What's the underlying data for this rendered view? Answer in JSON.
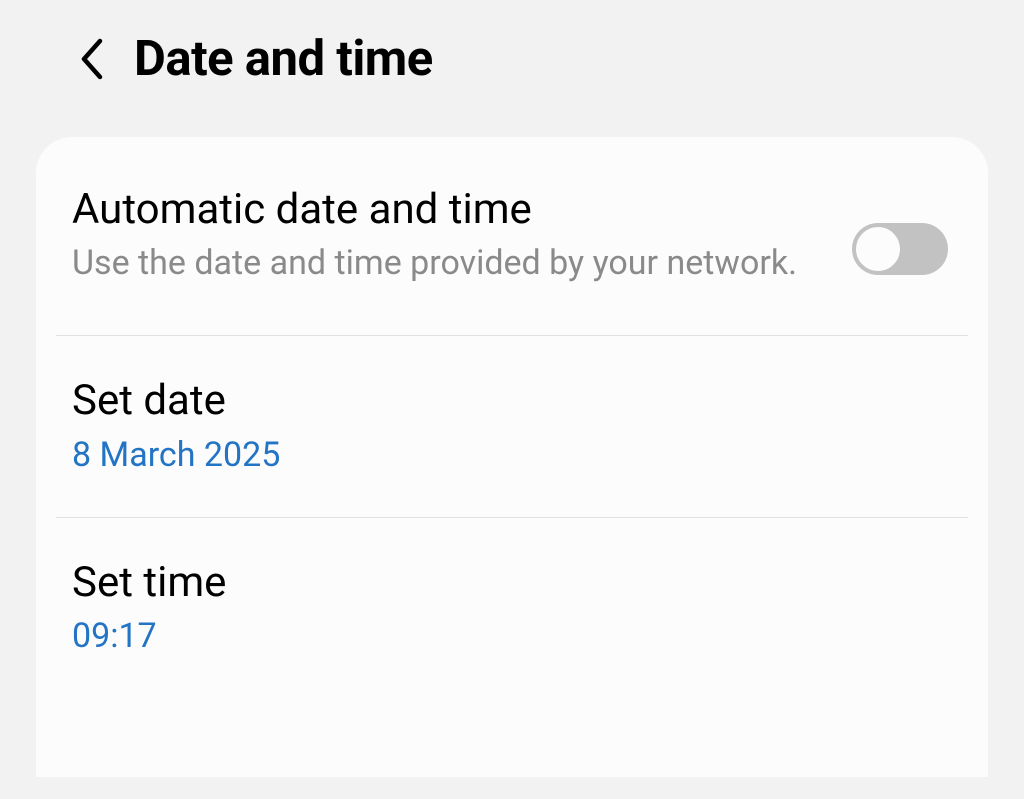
{
  "header": {
    "title": "Date and time"
  },
  "settings": {
    "auto": {
      "title": "Automatic date and time",
      "subtitle": "Use the date and time provided by your network.",
      "enabled": false
    },
    "set_date": {
      "title": "Set date",
      "value": "8 March 2025"
    },
    "set_time": {
      "title": "Set time",
      "value": "09:17"
    }
  }
}
